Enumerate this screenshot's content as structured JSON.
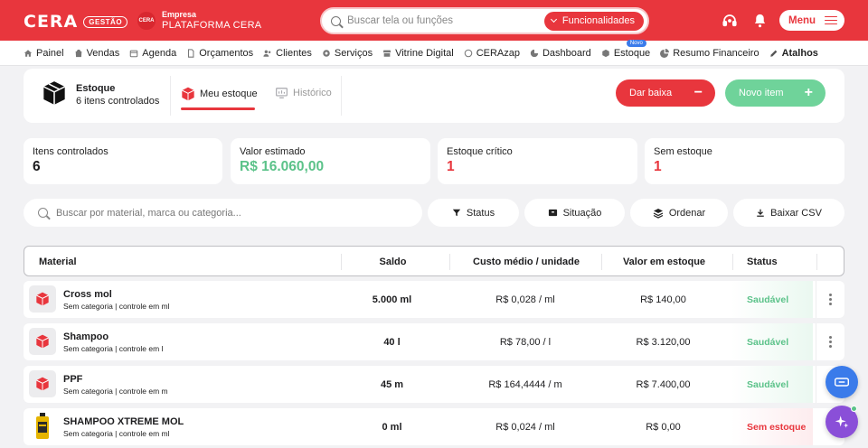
{
  "header": {
    "logo_text": "CERA",
    "logo_badge": "GESTÃO",
    "company_avatar_text": "CERA",
    "company_label": "Empresa",
    "company_name": "PLATAFORMA CERA",
    "search_placeholder": "Buscar tela ou funções",
    "features_label": "Funcionalidades",
    "menu_label": "Menu",
    "support_icon": "headset-icon",
    "notification_icon": "bell-icon"
  },
  "nav": {
    "items": [
      {
        "label": "Painel",
        "icon": "home-icon"
      },
      {
        "label": "Vendas",
        "icon": "bag-icon"
      },
      {
        "label": "Agenda",
        "icon": "calendar-icon"
      },
      {
        "label": "Orçamentos",
        "icon": "document-icon"
      },
      {
        "label": "Clientes",
        "icon": "users-icon"
      },
      {
        "label": "Serviços",
        "icon": "gear-icon"
      },
      {
        "label": "Vitrine Digital",
        "icon": "store-icon"
      },
      {
        "label": "CERAzap",
        "icon": "whatsapp-icon"
      },
      {
        "label": "Dashboard",
        "icon": "chart-icon"
      },
      {
        "label": "Estoque",
        "icon": "box-icon",
        "badge": "Novo"
      },
      {
        "label": "Resumo Financeiro",
        "icon": "pie-icon"
      },
      {
        "label": "Atalhos",
        "icon": "pencil-icon"
      }
    ]
  },
  "estoque": {
    "title": "Estoque",
    "subtitle": "6 itens controlados",
    "tab_meu": "Meu estoque",
    "tab_historico": "Histórico",
    "btn_baixa": "Dar baixa",
    "btn_novo": "Novo item"
  },
  "stats": [
    {
      "label": "Itens controlados",
      "value": "6",
      "color": "#1d1d1f"
    },
    {
      "label": "Valor estimado",
      "value": "R$ 16.060,00",
      "color": "#5bc289"
    },
    {
      "label": "Estoque crítico",
      "value": "1",
      "color": "#e8363d"
    },
    {
      "label": "Sem estoque",
      "value": "1",
      "color": "#e8363d"
    }
  ],
  "filters": {
    "search_placeholder": "Buscar por material, marca ou categoria...",
    "status": "Status",
    "situacao": "Situação",
    "ordenar": "Ordenar",
    "csv": "Baixar CSV"
  },
  "table": {
    "columns": {
      "material": "Material",
      "saldo": "Saldo",
      "custo": "Custo médio / unidade",
      "valor": "Valor em estoque",
      "status": "Status"
    },
    "rows": [
      {
        "name": "Cross mol",
        "sub": "Sem categoria | controle em ml",
        "saldo": "5.000 ml",
        "custo": "R$ 0,028 / ml",
        "valor": "R$ 140,00",
        "status": "Saudável",
        "status_kind": "ok",
        "thumb": "box-icon"
      },
      {
        "name": "Shampoo",
        "sub": "Sem categoria | controle em l",
        "saldo": "40 l",
        "custo": "R$ 78,00 / l",
        "valor": "R$ 3.120,00",
        "status": "Saudável",
        "status_kind": "ok",
        "thumb": "box-icon"
      },
      {
        "name": "PPF",
        "sub": "Sem categoria | controle em m",
        "saldo": "45 m",
        "custo": "R$ 164,4444 / m",
        "valor": "R$ 7.400,00",
        "status": "Saudável",
        "status_kind": "ok",
        "thumb": "box-icon"
      },
      {
        "name": "SHAMPOO XTREME MOL",
        "sub": "Sem categoria | controle em ml",
        "saldo": "0 ml",
        "custo": "R$ 0,024 / ml",
        "valor": "R$ 0,00",
        "status": "Sem estoque",
        "status_kind": "bad",
        "thumb": "bottle-image"
      }
    ]
  },
  "colors": {
    "brand": "#e8363d",
    "success": "#5bc289",
    "fab_blue": "#3a7bea",
    "fab_purple": "#8a4fd8"
  }
}
